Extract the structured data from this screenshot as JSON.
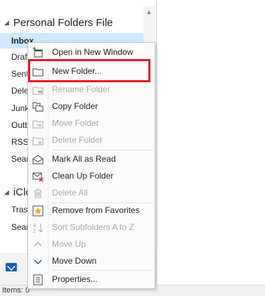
{
  "folder_pane": {
    "groups": [
      {
        "name": "Personal Folders File"
      },
      {
        "name": "iClo"
      }
    ],
    "folders": [
      {
        "label": "Inbox",
        "selected": true
      },
      {
        "label": "Draf"
      },
      {
        "label": "Sent"
      },
      {
        "label": "Dele"
      },
      {
        "label": "Junk"
      },
      {
        "label": "Outb"
      },
      {
        "label": "RSS"
      },
      {
        "label": "Sear"
      }
    ],
    "folders2": [
      {
        "label": "Tras"
      },
      {
        "label": "Sear"
      }
    ]
  },
  "context_menu": {
    "items": [
      {
        "label": "Open in New Window",
        "icon": "open-new-window-icon",
        "enabled": true
      },
      {
        "label": "New Folder...",
        "icon": "new-folder-icon",
        "enabled": true
      },
      {
        "label": "Rename Folder",
        "icon": "rename-folder-icon",
        "enabled": false
      },
      {
        "label": "Copy Folder",
        "icon": "copy-folder-icon",
        "enabled": true
      },
      {
        "label": "Move Folder",
        "icon": "move-folder-icon",
        "enabled": false
      },
      {
        "label": "Delete Folder",
        "icon": "delete-folder-icon",
        "enabled": false
      },
      {
        "label": "Mark All as Read",
        "icon": "mark-read-icon",
        "enabled": true
      },
      {
        "label": "Clean Up Folder",
        "icon": "clean-up-folder-icon",
        "enabled": true
      },
      {
        "label": "Delete All",
        "icon": "delete-all-icon",
        "enabled": false
      },
      {
        "label": "Remove from Favorites",
        "icon": "favorites-star-icon",
        "enabled": true
      },
      {
        "label": "Sort Subfolders A to Z",
        "icon": "sort-az-icon",
        "enabled": false
      },
      {
        "label": "Move Up",
        "icon": "chevron-up-icon",
        "enabled": false
      },
      {
        "label": "Move Down",
        "icon": "chevron-down-icon",
        "enabled": true
      },
      {
        "label": "Properties...",
        "icon": "properties-icon",
        "enabled": true
      }
    ]
  },
  "status_bar": {
    "items_text": "Items: 0"
  },
  "colors": {
    "highlight": "#e21b25",
    "selected": "#cde8ff",
    "accent": "#1a5fb4"
  }
}
